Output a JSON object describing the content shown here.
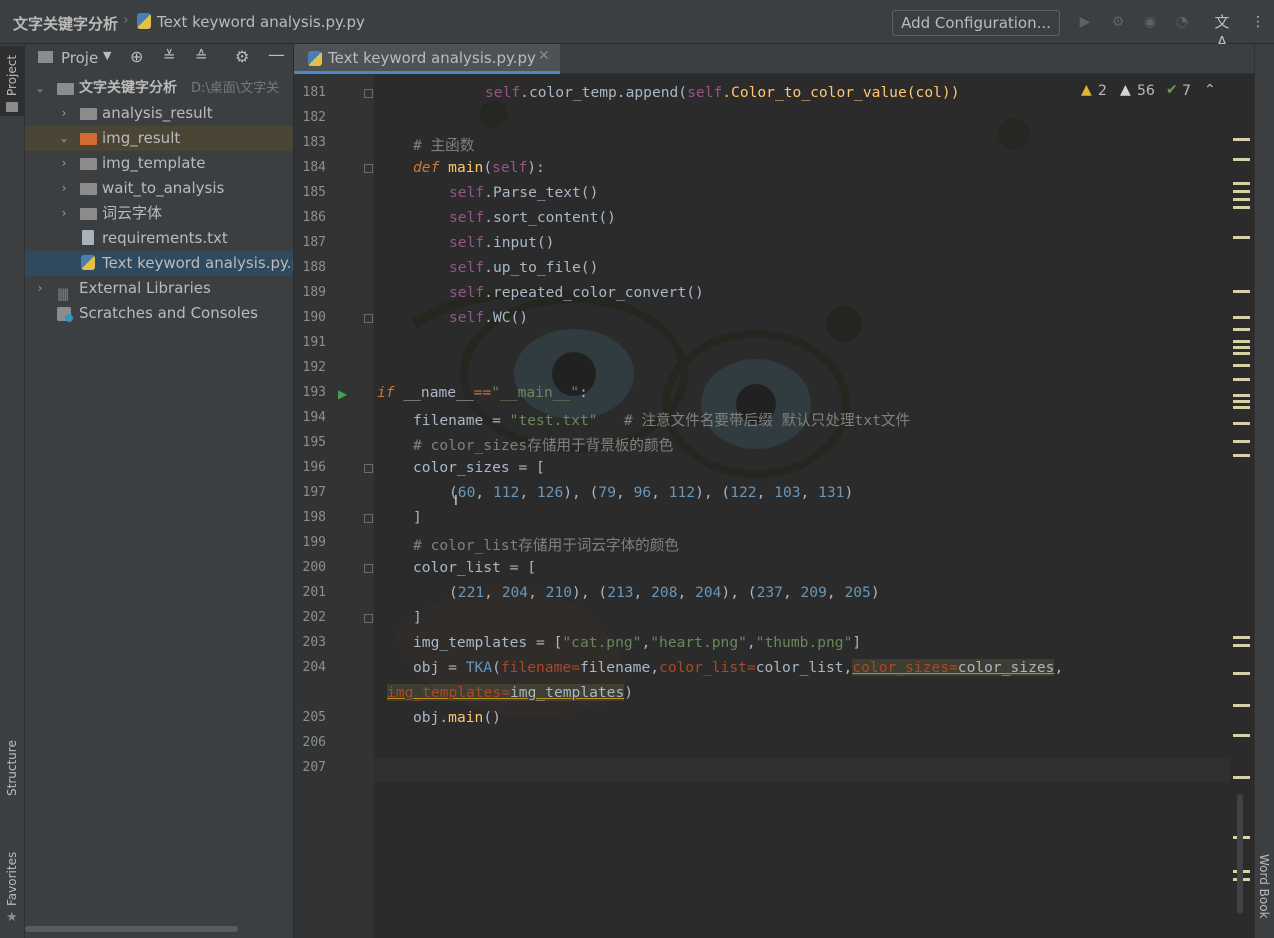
{
  "breadcrumb": {
    "project": "文字关键字分析",
    "file": "Text keyword analysis.py.py"
  },
  "toolbar": {
    "add_configuration": "Add Configuration..."
  },
  "left_stripe": {
    "project_label": "Project",
    "structure_label": "Structure",
    "favorites_label": "Favorites"
  },
  "right_stripe": {
    "word_book_label": "Word Book"
  },
  "project_panel": {
    "title": "Proje",
    "root_name": "文字关键字分析",
    "root_path": "D:\\桌面\\文字关",
    "items": [
      {
        "label": "analysis_result"
      },
      {
        "label": "img_result"
      },
      {
        "label": "img_template"
      },
      {
        "label": "wait_to_analysis"
      },
      {
        "label": "词云字体"
      },
      {
        "label": "requirements.txt"
      },
      {
        "label": "Text keyword analysis.py.p"
      }
    ],
    "external_libraries": "External Libraries",
    "scratches": "Scratches and Consoles"
  },
  "editor": {
    "tab_label": "Text keyword analysis.py.py",
    "inspection": {
      "warnings": "2",
      "weak_warnings": "56",
      "typos": "7"
    },
    "line_numbers": [
      "181",
      "182",
      "183",
      "184",
      "185",
      "186",
      "187",
      "188",
      "189",
      "190",
      "191",
      "192",
      "193",
      "194",
      "195",
      "196",
      "197",
      "198",
      "199",
      "200",
      "201",
      "202",
      "203",
      "204",
      "205",
      "206",
      "207"
    ],
    "code": {
      "l181_a": "self",
      "l181_b": ".color_temp.append(",
      "l181_c": "self",
      "l181_d": ".Color_to_color_value(col))",
      "l183": "# 主函数",
      "l184_kw": "def ",
      "l184_fn": "main",
      "l184_b": "(",
      "l184_self": "self",
      "l184_c": "):",
      "l185_self": "self",
      "l185": ".Parse_text()",
      "l186_self": "self",
      "l186": ".sort_content()",
      "l187_self": "self",
      "l187": ".input()",
      "l188_self": "self",
      "l188": ".up_to_file()",
      "l189_self": "self",
      "l189": ".repeated_color_convert()",
      "l190_self": "self",
      "l190": ".WC()",
      "l193_kw": "if ",
      "l193_a": "__name__",
      "l193_op": "==",
      "l193_str": "\"__main__\"",
      "l193_c": ":",
      "l194_a": "filename",
      "l194_op": " = ",
      "l194_str": "\"test.txt\"",
      "l194_cmt": "   # 注意文件名要带后缀 默认只处理txt文件",
      "l195": "# color_sizes存储用于背景板的颜色",
      "l196_a": "color_sizes",
      "l196_b": " = [",
      "l197_a": "(",
      "l197_n1": "60",
      "l197_s1": ", ",
      "l197_n2": "112",
      "l197_s2": ", ",
      "l197_n3": "126",
      "l197_s3": "), (",
      "l197_n4": "79",
      "l197_s4": ", ",
      "l197_n5": "96",
      "l197_s5": ", ",
      "l197_n6": "112",
      "l197_s6": "), (",
      "l197_n7": "122",
      "l197_s7": ", ",
      "l197_n8": "103",
      "l197_s8": ", ",
      "l197_n9": "131",
      "l197_s9": ")",
      "l198": "]",
      "l199": "# color_list存储用于词云字体的颜色",
      "l200_a": "color_list",
      "l200_b": " = [",
      "l201_a": "(",
      "l201_n1": "221",
      "l201_s1": ", ",
      "l201_n2": "204",
      "l201_s2": ", ",
      "l201_n3": "210",
      "l201_s3": "), (",
      "l201_n4": "213",
      "l201_s4": ", ",
      "l201_n5": "208",
      "l201_s5": ", ",
      "l201_n6": "204",
      "l201_s6": "), (",
      "l201_n7": "237",
      "l201_s7": ", ",
      "l201_n8": "209",
      "l201_s8": ", ",
      "l201_n9": "205",
      "l201_s9": ")",
      "l202": "]",
      "l203_a": "img_templates = [",
      "l203_s1": "\"cat.png\"",
      "l203_c1": ",",
      "l203_s2": "\"heart.png\"",
      "l203_c2": ",",
      "l203_s3": "\"thumb.png\"",
      "l203_e": "]",
      "l204_a": "obj = ",
      "l204_cls": "TKA",
      "l204_p": "(",
      "l204_k1": "filename=",
      "l204_v1": "filename,",
      "l204_k2": "color_list=",
      "l204_v2": "color_list,",
      "l204_k3": "color_sizes=",
      "l204_v3": "color_sizes",
      "l204_e": ",",
      "l204w_k": "img_templates=",
      "l204w_v": "img_templates",
      "l204w_e": ")",
      "l205_a": "obj.",
      "l205_b": "main",
      "l205_c": "()"
    }
  },
  "colors": {
    "keyword": "#cc7832",
    "string": "#6a8759",
    "number": "#6897bb",
    "self": "#94558d",
    "function": "#ffc66d",
    "comment": "#808080"
  }
}
